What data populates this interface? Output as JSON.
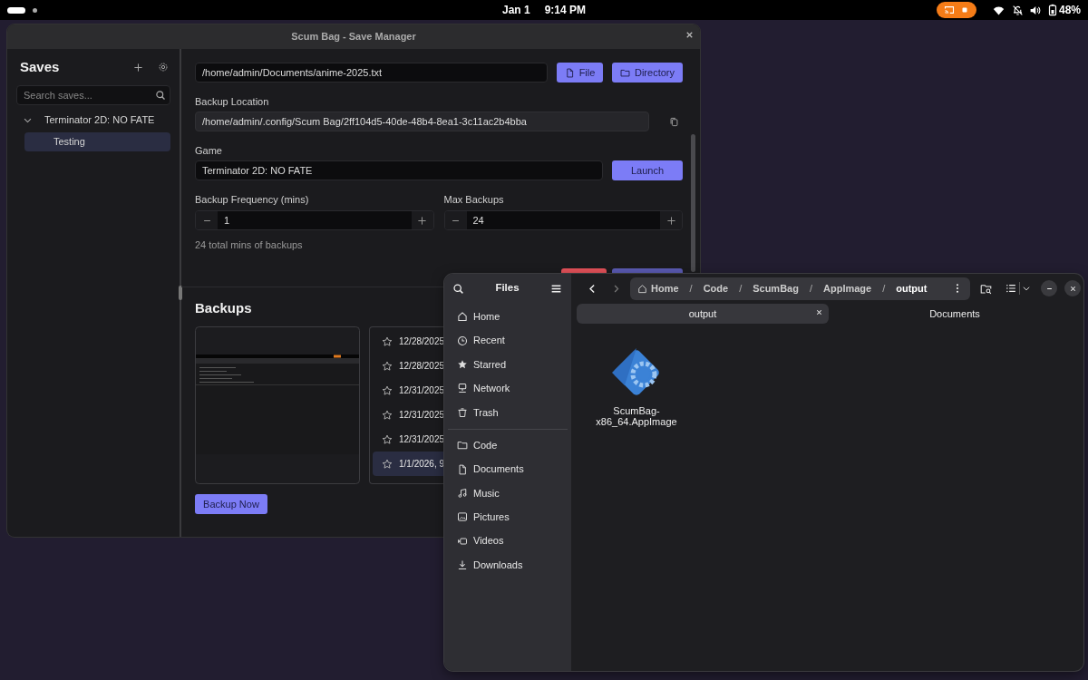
{
  "top_bar": {
    "date": "Jan 1",
    "time": "9:14 PM",
    "battery": "48%"
  },
  "save_manager": {
    "title": "Scum Bag - Save Manager",
    "sidebar": {
      "title": "Saves",
      "search_placeholder": "Search saves...",
      "tree": [
        {
          "label": "Terminator 2D: NO FATE",
          "expanded": true,
          "selected": false,
          "children": [
            {
              "label": "Testing",
              "selected": true
            }
          ]
        }
      ]
    },
    "save_path": "/home/admin/Documents/anime-2025.txt",
    "path_buttons": [
      {
        "label": "File",
        "kind": "file"
      },
      {
        "label": "Directory",
        "kind": "folder"
      }
    ],
    "backup_location": {
      "label": "Backup Location",
      "value": "/home/admin/.config/Scum Bag/2ff104d5-40de-48b4-8ea1-3c11ac2b4bba"
    },
    "game": {
      "label": "Game",
      "value": "Terminator 2D: NO FATE",
      "button": "Launch"
    },
    "frequency": {
      "label": "Backup Frequency (mins)",
      "value": "1"
    },
    "max_backups": {
      "label": "Max Backups",
      "value": "24"
    },
    "summary": "24 total mins of backups",
    "action_buttons": [
      {
        "kind": "danger"
      },
      {
        "kind": "primary"
      }
    ],
    "backups": {
      "title": "Backups",
      "items": [
        {
          "label": "12/28/2025",
          "starred": false,
          "selected": false
        },
        {
          "label": "12/28/2025",
          "starred": false,
          "selected": false
        },
        {
          "label": "12/31/2025",
          "starred": false,
          "selected": false
        },
        {
          "label": "12/31/2025",
          "starred": false,
          "selected": false
        },
        {
          "label": "12/31/2025",
          "starred": false,
          "selected": false
        },
        {
          "label": "1/1/2026, 9",
          "starred": false,
          "selected": true
        }
      ],
      "button": "Backup Now"
    }
  },
  "files": {
    "title": "Files",
    "path": [
      {
        "label": "Home",
        "current": false
      },
      {
        "separator": "/",
        "label": "Code",
        "current": false
      },
      {
        "separator": "/",
        "label": "ScumBag",
        "current": false
      },
      {
        "separator": "/",
        "label": "AppImage",
        "current": false
      },
      {
        "separator": "/",
        "label": "output",
        "current": true
      }
    ],
    "tabs": [
      {
        "label": "output",
        "selected": true
      },
      {
        "label": "Documents",
        "selected": false
      }
    ],
    "places": [
      {
        "label": "Home"
      },
      {
        "label": "Recent"
      },
      {
        "label": "Starred"
      },
      {
        "label": "Network"
      },
      {
        "label": "Trash"
      }
    ],
    "bookmarks": [
      {
        "label": "Code"
      },
      {
        "label": "Documents"
      },
      {
        "label": "Music"
      },
      {
        "label": "Pictures"
      },
      {
        "label": "Videos"
      },
      {
        "label": "Downloads"
      }
    ],
    "items": [
      {
        "name": "ScumBag-x86_64.AppImage"
      }
    ]
  }
}
